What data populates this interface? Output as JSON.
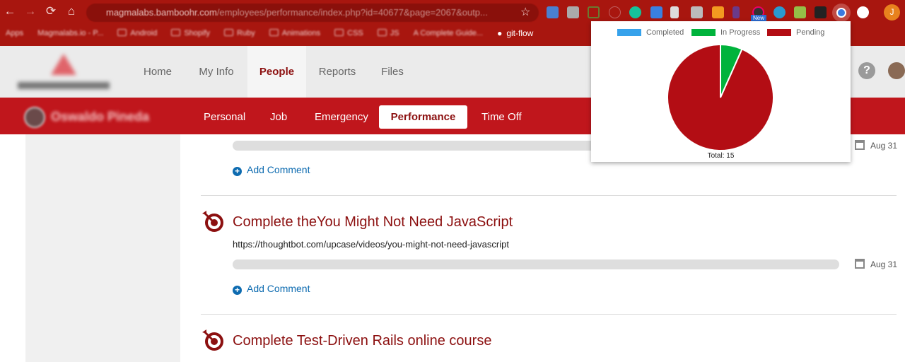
{
  "browser": {
    "url": "magmalabs.bamboohr.com/employees/performance/index.php?id=40677&page=2067&outp...",
    "url_domain": "magmalabs.bamboohr.com",
    "url_path": "/employees/performance/index.php?id=40677&page=2067&outp...",
    "extension_badge": "New",
    "profile_initial": "J",
    "bookmarks": [
      "Apps",
      "Magmalabs.io - P...",
      "Android",
      "Shopify",
      "Ruby",
      "Animations",
      "CSS",
      "JS",
      "A Complete Guide...",
      "git-flow"
    ]
  },
  "app": {
    "nav": [
      "Home",
      "My Info",
      "People",
      "Reports",
      "Files"
    ],
    "active_nav": "People",
    "employee_name": "Oswaldo Pineda",
    "subtabs": [
      "Personal",
      "Job",
      "Emergency",
      "Performance",
      "Time Off"
    ],
    "active_subtab": "Performance"
  },
  "goals": [
    {
      "title": "",
      "url": "",
      "progress": 0,
      "date": "Aug 31",
      "add_comment": "Add Comment"
    },
    {
      "title": "Complete theYou Might Not Need JavaScript",
      "url": "https://thoughtbot.com/upcase/videos/you-might-not-need-javascript",
      "progress": 0,
      "date": "Aug 31",
      "add_comment": "Add Comment"
    },
    {
      "title": "Complete Test-Driven Rails online course"
    }
  ],
  "chart_data": {
    "type": "pie",
    "categories": [
      "Completed",
      "In Progress",
      "Pending"
    ],
    "values": [
      0,
      1,
      14
    ],
    "colors": [
      "#36a2eb",
      "#00b33c",
      "#b30d14"
    ],
    "legend": "top",
    "footer": "Total: 15"
  }
}
